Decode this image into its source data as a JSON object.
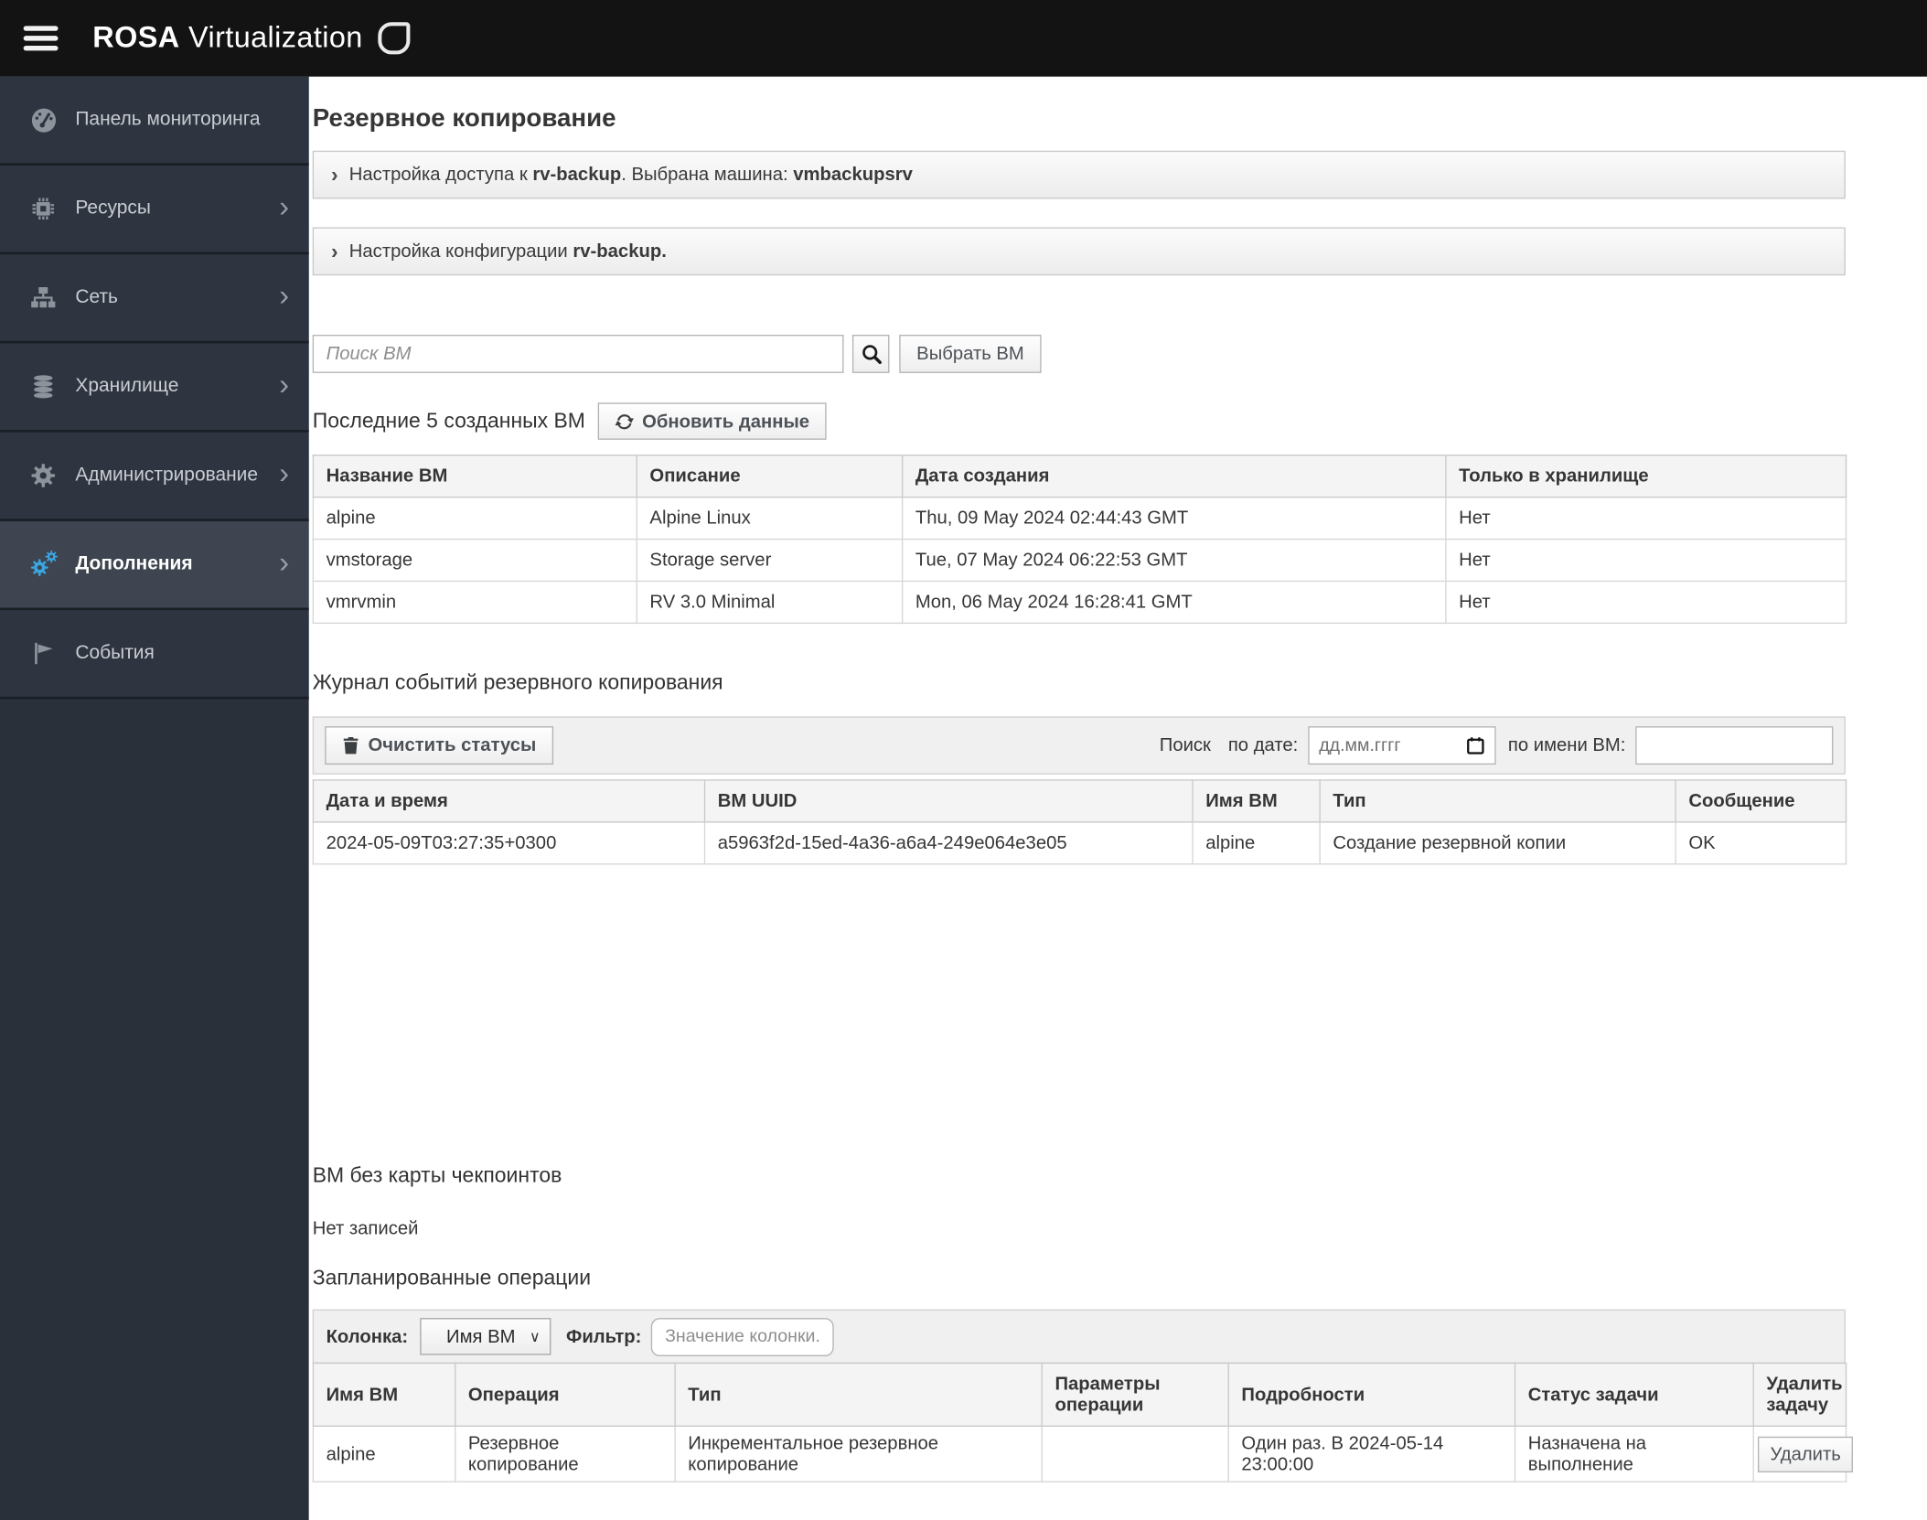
{
  "colors": {
    "topbar_bg": "#131313",
    "sidebar_bg": "#2e3440",
    "sidebar_selected_bg": "#3e4551",
    "accent_blue": "#3aa5de"
  },
  "topbar": {
    "brand_bold": "ROSA",
    "brand_rest": "Virtualization"
  },
  "sidebar": {
    "items": [
      {
        "label": "Панель мониторинга"
      },
      {
        "label": "Ресурсы"
      },
      {
        "label": "Сеть"
      },
      {
        "label": "Хранилище"
      },
      {
        "label": "Администрирование"
      },
      {
        "label": "Дополнения"
      },
      {
        "label": "События"
      }
    ]
  },
  "page": {
    "title": "Резервное копирование"
  },
  "accordions": [
    {
      "chevron": "›",
      "prefix": "Настройка доступа к ",
      "bold1": "rv-backup",
      "middle": ". Выбрана машина: ",
      "bold2": "vmbackupsrv"
    },
    {
      "chevron": "›",
      "prefix": "Настройка конфигурации ",
      "bold1": "rv-backup.",
      "middle": "",
      "bold2": ""
    }
  ],
  "search": {
    "placeholder": "Поиск ВМ",
    "select_button": "Выбрать ВМ"
  },
  "recent": {
    "title": "Последние 5 созданных ВМ",
    "refresh_button": "Обновить данные",
    "headers": [
      "Название ВМ",
      "Описание",
      "Дата создания",
      "Только в хранилище"
    ],
    "rows": [
      [
        "alpine",
        "Alpine Linux",
        "Thu, 09 May 2024 02:44:43 GMT",
        "Нет"
      ],
      [
        "vmstorage",
        "Storage server",
        "Tue, 07 May 2024 06:22:53 GMT",
        "Нет"
      ],
      [
        "vmrvmin",
        "RV 3.0 Minimal",
        "Mon, 06 May 2024 16:28:41 GMT",
        "Нет"
      ]
    ]
  },
  "journal": {
    "title": "Журнал событий резервного копирования",
    "clear_button": "Очистить статусы",
    "search_label": "Поиск",
    "date_label": "по дате:",
    "date_placeholder": "дд.мм.гггг",
    "name_label": "по имени ВМ:",
    "headers": [
      "Дата и время",
      "ВМ UUID",
      "Имя ВМ",
      "Тип",
      "Сообщение"
    ],
    "rows": [
      [
        "2024-05-09T03:27:35+0300",
        "a5963f2d-15ed-4a36-a6a4-249e064e3e05",
        "alpine",
        "Создание резервной копии",
        "OK"
      ]
    ]
  },
  "checkpoints": {
    "title": "ВМ без карты чекпоинтов",
    "empty": "Нет записей"
  },
  "scheduled": {
    "title": "Запланированные операции",
    "column_label": "Колонка:",
    "column_value": "Имя ВМ",
    "filter_label": "Фильтр:",
    "filter_placeholder": "Значение колонки...",
    "headers": [
      "Имя ВМ",
      "Операция",
      "Тип",
      "Параметры операции",
      "Подробности",
      "Статус задачи",
      "Удалить задачу"
    ],
    "rows": [
      [
        "alpine",
        "Резервное копирование",
        "Инкрементальное резервное копирование",
        "",
        "Один раз. В 2024-05-14 23:00:00",
        "Назначена на выполнение"
      ]
    ],
    "delete_button": "Удалить"
  }
}
